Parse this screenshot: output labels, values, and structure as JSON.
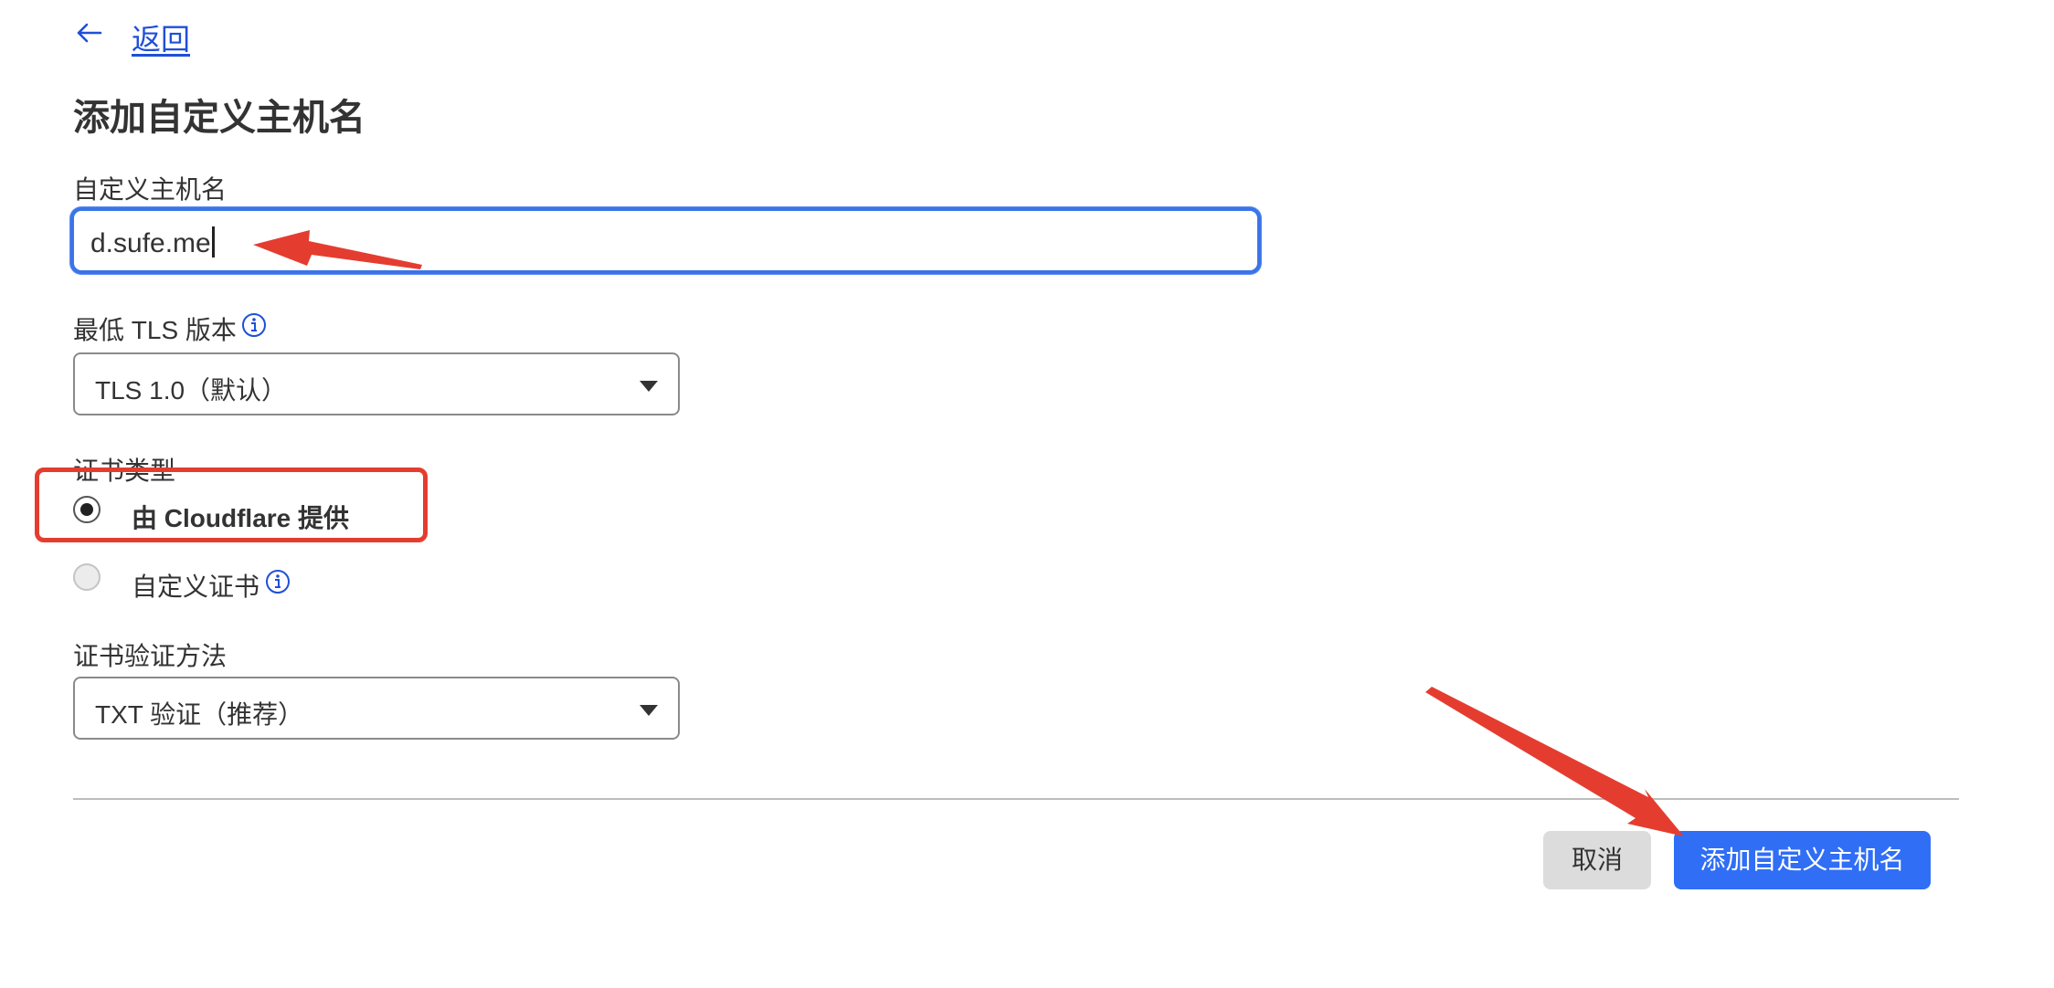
{
  "nav": {
    "back_label": "返回"
  },
  "page": {
    "title": "添加自定义主机名"
  },
  "hostname": {
    "label": "自定义主机名",
    "value": "d.sufe.me"
  },
  "tls": {
    "label": "最低 TLS 版本",
    "selected": "TLS 1.0（默认）"
  },
  "certificate": {
    "label": "证书类型",
    "options": [
      {
        "label": "由 Cloudflare 提供",
        "selected": true
      },
      {
        "label": "自定义证书",
        "selected": false
      }
    ]
  },
  "validation": {
    "label": "证书验证方法",
    "selected": "TXT 验证（推荐）"
  },
  "actions": {
    "cancel_label": "取消",
    "submit_label": "添加自定义主机名"
  },
  "colors": {
    "accent": "#2f6ef5",
    "link": "#1f4fd8",
    "annotation": "#e43d30"
  }
}
